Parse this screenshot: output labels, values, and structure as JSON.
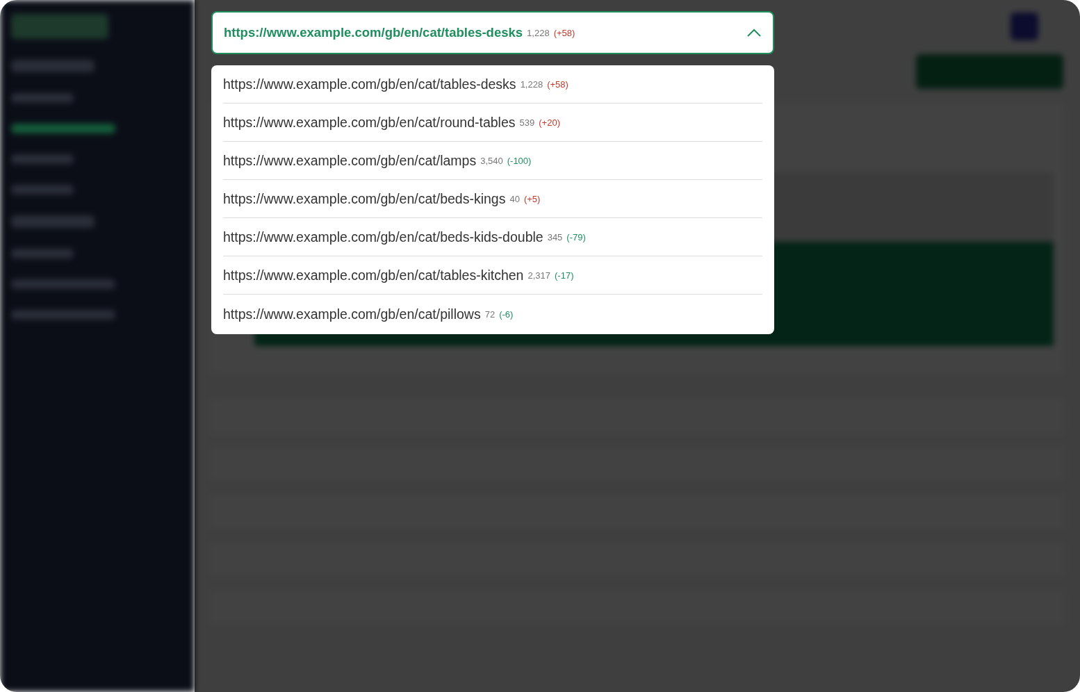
{
  "url_dropdown": {
    "expanded": true,
    "current": {
      "url": "https://www.example.com/gb/en/cat/tables-desks",
      "count": "1,228",
      "delta": "(+58)",
      "color": "#c0392b"
    },
    "options": [
      {
        "url": "https://www.example.com/gb/en/cat/tables-desks",
        "count": "1,228",
        "delta": "(+58)",
        "color": "#c0392b"
      },
      {
        "url": "https://www.example.com/gb/en/cat/round-tables",
        "count": "539",
        "delta": "(+20)",
        "color": "#c0392b"
      },
      {
        "url": "https://www.example.com/gb/en/cat/lamps",
        "count": "3,540",
        "delta": "(-100)",
        "color": "#1f8f5f"
      },
      {
        "url": "https://www.example.com/gb/en/cat/beds-kings",
        "count": "40",
        "delta": "(+5)",
        "color": "#c0392b"
      },
      {
        "url": "https://www.example.com/gb/en/cat/beds-kids-double",
        "count": "345",
        "delta": "(-79)",
        "color": "#1f8f5f"
      },
      {
        "url": "https://www.example.com/gb/en/cat/tables-kitchen",
        "count": "2,317",
        "delta": "(-17)",
        "color": "#1f8f5f"
      },
      {
        "url": "https://www.example.com/gb/en/cat/pillows",
        "count": "72",
        "delta": "(-6)",
        "color": "#1f8f5f"
      }
    ]
  }
}
